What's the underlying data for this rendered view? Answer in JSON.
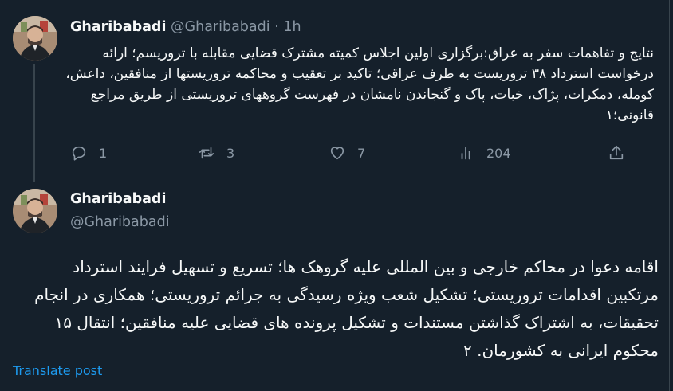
{
  "thread_tweet": {
    "display_name": "Gharibabadi",
    "handle": "@Gharibabadi",
    "separator": "·",
    "time": "1h",
    "text": "نتایج و تفاهمات سفر به عراق:برگزاری اولین اجلاس کمیته مشترک قضایی مقابله با تروریسم؛ ارائه درخواست استرداد ۳۸ تروریست به طرف عراقی؛ تاکید بر تعقیب و محاکمه تروریستها از منافقین، داعش، کومله، دمکرات، پژاک، خبات، پاک و گنجاندن نامشان در فهرست گروههای تروریستی از طریق مراجع قانونی؛۱",
    "actions": {
      "replies": {
        "icon": "reply-icon",
        "count": "1"
      },
      "reposts": {
        "icon": "repost-icon",
        "count": "3"
      },
      "likes": {
        "icon": "heart-icon",
        "count": "7"
      },
      "views": {
        "icon": "views-icon",
        "count": "204"
      },
      "share": {
        "icon": "share-icon"
      }
    }
  },
  "main_tweet": {
    "display_name": "Gharibabadi",
    "handle": "@Gharibabadi",
    "text": "اقامه دعوا در محاکم خارجی و بین المللی علیه گروهک ها؛ تسریع و تسهیل فرایند استرداد مرتکبین اقدامات تروریستی؛ تشکیل شعب ویژه رسیدگی به جرائم تروریستی؛ همکاری در انجام تحقیقات، به اشتراک گذاشتن مستندات و تشکیل پرونده های قضایی علیه منافقین؛ انتقال ۱۵ محکوم ایرانی به کشورمان. ۲",
    "translate_label": "Translate post"
  },
  "colors": {
    "background": "#15202b",
    "text": "#f7f9f9",
    "muted": "#8b98a5",
    "accent": "#1d9bf0",
    "divider": "#38444d"
  }
}
